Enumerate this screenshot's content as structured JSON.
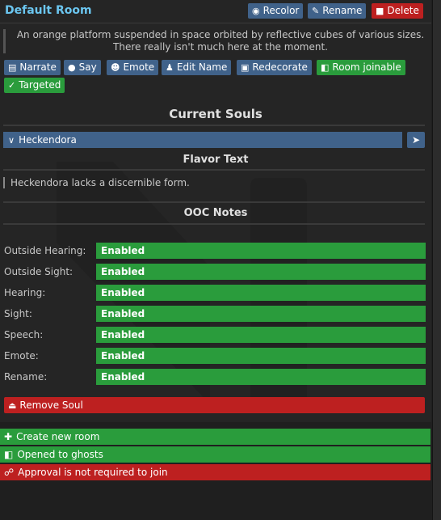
{
  "room": {
    "title": "Default Room",
    "description": "An orange platform suspended in space orbited by reflective cubes of various sizes. There really isn't much here at the moment."
  },
  "header_buttons": {
    "recolor": "Recolor",
    "rename": "Rename",
    "delete": "Delete"
  },
  "actions": {
    "narrate": "Narrate",
    "say": "Say",
    "emote": "Emote",
    "edit_name": "Edit Name",
    "redecorate": "Redecorate",
    "room_joinable": "Room joinable",
    "targeted": "Targeted"
  },
  "souls": {
    "section_title": "Current Souls",
    "selected": "Heckendora",
    "flavor_title": "Flavor Text",
    "flavor_text": "Heckendora lacks a discernible form.",
    "ooc_title": "OOC Notes",
    "settings": [
      {
        "label": "Outside Hearing:",
        "value": "Enabled"
      },
      {
        "label": "Outside Sight:",
        "value": "Enabled"
      },
      {
        "label": "Hearing:",
        "value": "Enabled"
      },
      {
        "label": "Sight:",
        "value": "Enabled"
      },
      {
        "label": "Speech:",
        "value": "Enabled"
      },
      {
        "label": "Emote:",
        "value": "Enabled"
      },
      {
        "label": "Rename:",
        "value": "Enabled"
      }
    ],
    "remove": "Remove Soul"
  },
  "bottom": {
    "create": "Create new room",
    "ghosts": "Opened to ghosts",
    "approval": "Approval is not required to join"
  },
  "colors": {
    "accent": "#6bc6f0",
    "blue": "#40628a",
    "green": "#2a9c3c",
    "red": "#bd2020"
  }
}
